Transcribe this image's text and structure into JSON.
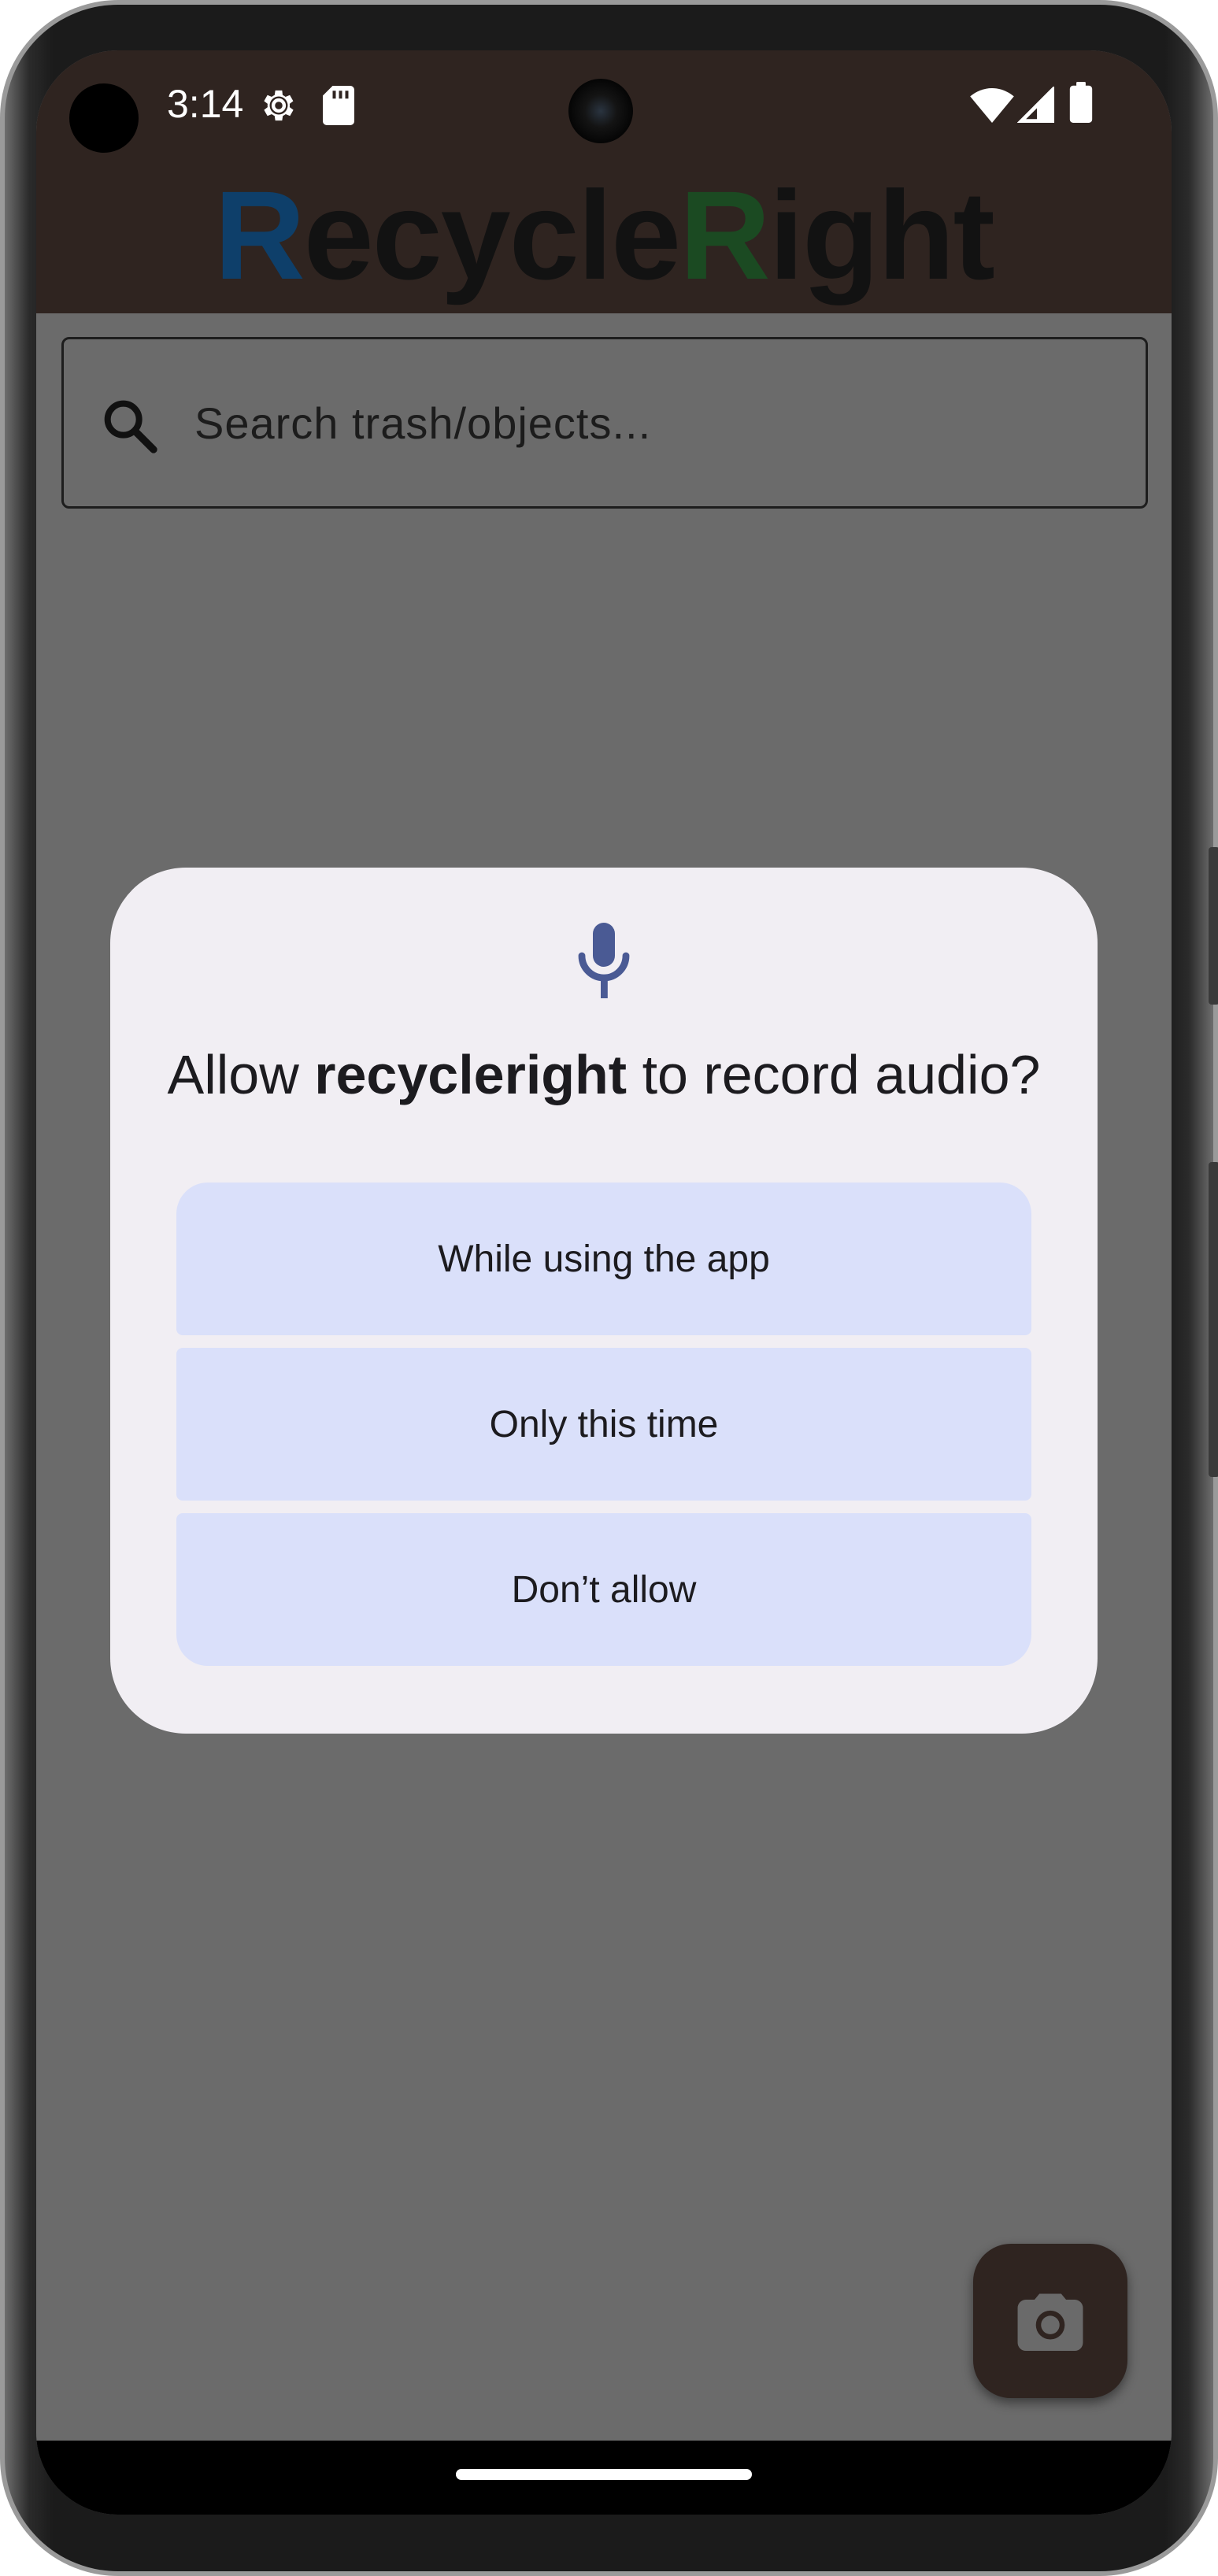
{
  "status_bar": {
    "time": "3:14",
    "icons": [
      "settings-gear-icon",
      "sd-card-icon",
      "wifi-icon",
      "cell-signal-icon",
      "battery-icon"
    ]
  },
  "app": {
    "title_parts": {
      "r1": "R",
      "p1": "ecycle",
      "r2": "R",
      "p2": "ight"
    },
    "colors": {
      "header_bg": "#2f2420",
      "title_r1": "#0e3f6a",
      "title_r2": "#1b4a22",
      "scrim_bg": "#6b6b6b"
    }
  },
  "search": {
    "placeholder": "Search trash/objects...",
    "icon": "search-icon"
  },
  "fab": {
    "icon": "camera-icon"
  },
  "permission_dialog": {
    "icon": "microphone-icon",
    "title_prefix": "Allow ",
    "app_name": "recycleright",
    "title_suffix": " to record audio?",
    "options": [
      "While using the app",
      "Only this time",
      "Don’t allow"
    ],
    "colors": {
      "dialog_bg": "#f1eef3",
      "option_bg": "#dae0fa",
      "icon_color": "#4a5a94"
    }
  }
}
